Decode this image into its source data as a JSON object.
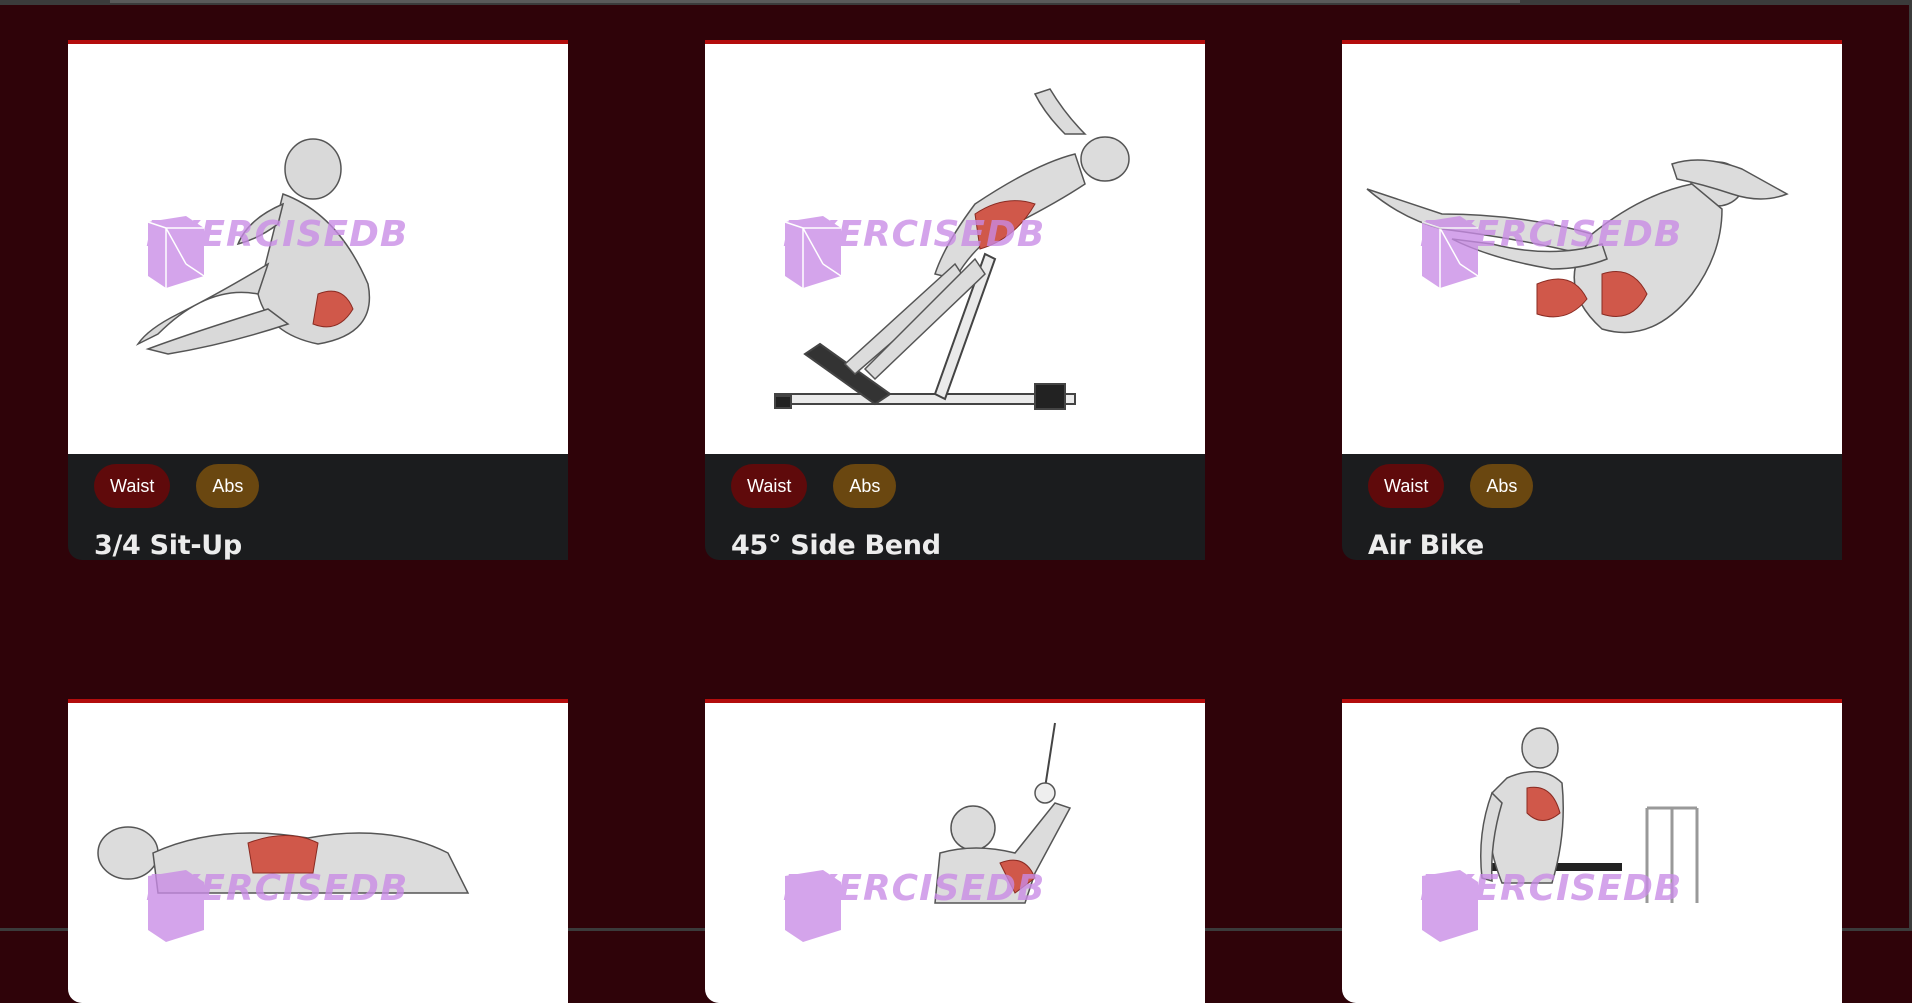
{
  "brand": {
    "watermark_text": "EXERCISEDB",
    "accent_color": "#b30d0d",
    "background_color": "#2f0309",
    "watermark_color": "#c98be6"
  },
  "cards": [
    {
      "title": "3/4 Sit-Up",
      "body_part": "Waist",
      "target": "Abs",
      "image_icon": "sit-up-illustration"
    },
    {
      "title": "45° Side Bend",
      "body_part": "Waist",
      "target": "Abs",
      "image_icon": "side-bend-illustration"
    },
    {
      "title": "Air Bike",
      "body_part": "Waist",
      "target": "Abs",
      "image_icon": "air-bike-illustration"
    },
    {
      "title": "",
      "body_part": "",
      "target": "",
      "image_icon": "crunch-illustration"
    },
    {
      "title": "",
      "body_part": "",
      "target": "",
      "image_icon": "cable-pull-illustration"
    },
    {
      "title": "",
      "body_part": "",
      "target": "",
      "image_icon": "dip-illustration"
    }
  ]
}
